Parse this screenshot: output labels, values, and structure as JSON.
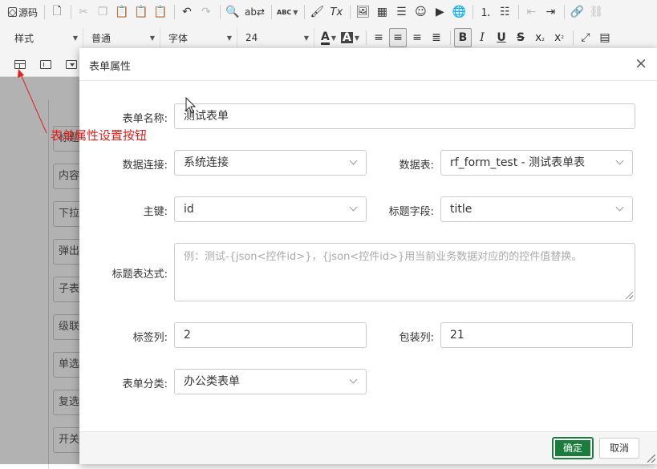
{
  "toolbar": {
    "source_label": "源码",
    "style_select": "样式",
    "format_select": "普通",
    "font_select": "字体",
    "size_select": "24",
    "font_color_glyph": "A",
    "bg_color_glyph": "A",
    "bold_glyph": "B",
    "italic_glyph": "I",
    "underline_glyph": "U",
    "strike_glyph": "S",
    "subscript_glyph": "x",
    "subscript_suffix": "₂",
    "superscript_glyph": "x",
    "superscript_suffix": "²",
    "clear_format_glyph": "Tx",
    "spell_glyph": "ABC"
  },
  "editor": {
    "left_items": [
      "标题",
      "内容",
      "下拉",
      "弹出",
      "子表",
      "级联",
      "单选",
      "复选",
      "开关"
    ]
  },
  "annotation": {
    "text": "表单属性设置按钮",
    "color": "#e0211c"
  },
  "dialog": {
    "title": "表单属性",
    "close_glyph": "×",
    "fields": {
      "form_name": {
        "label": "表单名称:",
        "value": "测试表单"
      },
      "db_connection": {
        "label": "数据连接:",
        "value": "系统连接"
      },
      "db_table": {
        "label": "数据表:",
        "value": "rf_form_test - 测试表单表"
      },
      "primary_key": {
        "label": "主键:",
        "value": "id"
      },
      "title_field": {
        "label": "标题字段:",
        "value": "title"
      },
      "title_expression": {
        "label": "标题表达式:",
        "placeholder": "例：测试-{json<控件id>}，{json<控件id>}用当前业务数据对应的的控件值替换。"
      },
      "label_columns": {
        "label": "标签列:",
        "value": "2"
      },
      "wrap_columns": {
        "label": "包装列:",
        "value": "21"
      },
      "form_category": {
        "label": "表单分类:",
        "value": "办公类表单"
      }
    },
    "ok_label": "确定",
    "cancel_label": "取消",
    "ok_color": "#1a7d3c"
  }
}
